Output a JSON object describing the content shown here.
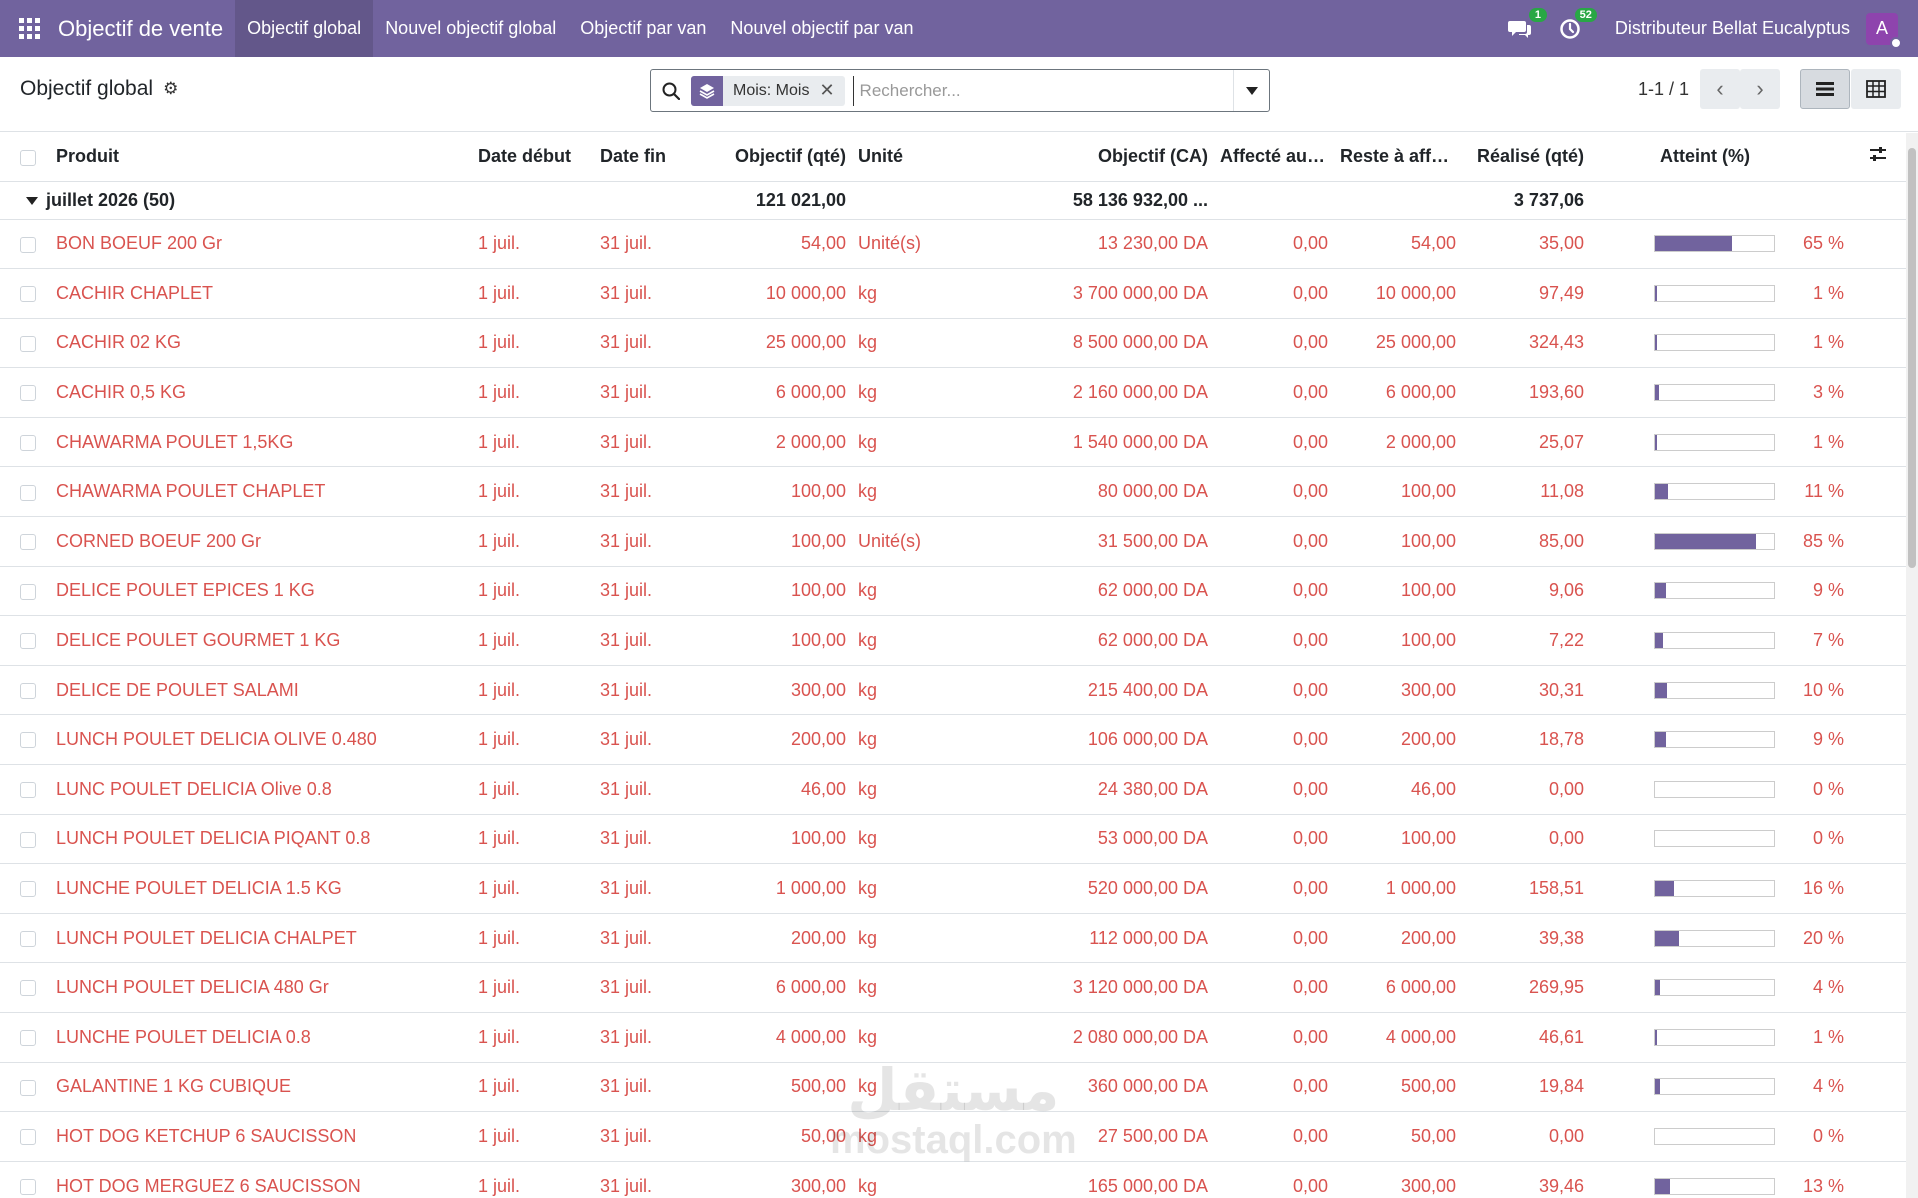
{
  "navbar": {
    "app_title": "Objectif de vente",
    "menu": [
      {
        "label": "Objectif global",
        "active": true
      },
      {
        "label": "Nouvel objectif global",
        "active": false
      },
      {
        "label": "Objectif par van",
        "active": false
      },
      {
        "label": "Nouvel objectif par van",
        "active": false
      }
    ],
    "messages_badge": "1",
    "activities_badge": "52",
    "company": "Distributeur Bellat Eucalyptus",
    "avatar_letter": "A",
    "colors": {
      "navbar_bg": "#71639e",
      "badge": "#28a745",
      "avatar": "#8e44ad"
    }
  },
  "control": {
    "breadcrumb": "Objectif global",
    "search": {
      "facet_label": "Mois: Mois",
      "placeholder": "Rechercher..."
    },
    "pager": "1-1 / 1",
    "views": [
      "list",
      "pivot"
    ]
  },
  "table": {
    "columns": [
      "Produit",
      "Date début",
      "Date fin",
      "Objectif (qté)",
      "Unité",
      "Objectif (CA)",
      "Affecté aux ...",
      "Reste à affec...",
      "Réalisé (qté)",
      "Atteint (%)"
    ],
    "group": {
      "label": "juillet 2026 (50)",
      "objectif_qte": "121 021,00",
      "objectif_ca": "58 136 932,00 ...",
      "realise_qte": "3 737,06"
    },
    "rows": [
      {
        "produit": "BON BOEUF 200 Gr",
        "debut": "1 juil.",
        "fin": "31 juil.",
        "obj_qte": "54,00",
        "unite": "Unité(s)",
        "obj_ca": "13 230,00 DA",
        "affecte": "0,00",
        "reste": "54,00",
        "realise": "35,00",
        "pct": "65 %",
        "progress": 65
      },
      {
        "produit": "CACHIR CHAPLET",
        "debut": "1 juil.",
        "fin": "31 juil.",
        "obj_qte": "10 000,00",
        "unite": "kg",
        "obj_ca": "3 700 000,00 DA",
        "affecte": "0,00",
        "reste": "10 000,00",
        "realise": "97,49",
        "pct": "1 %",
        "progress": 1
      },
      {
        "produit": "CACHIR 02 KG",
        "debut": "1 juil.",
        "fin": "31 juil.",
        "obj_qte": "25 000,00",
        "unite": "kg",
        "obj_ca": "8 500 000,00 DA",
        "affecte": "0,00",
        "reste": "25 000,00",
        "realise": "324,43",
        "pct": "1 %",
        "progress": 1
      },
      {
        "produit": "CACHIR 0,5 KG",
        "debut": "1 juil.",
        "fin": "31 juil.",
        "obj_qte": "6 000,00",
        "unite": "kg",
        "obj_ca": "2 160 000,00 DA",
        "affecte": "0,00",
        "reste": "6 000,00",
        "realise": "193,60",
        "pct": "3 %",
        "progress": 3
      },
      {
        "produit": "CHAWARMA POULET 1,5KG",
        "debut": "1 juil.",
        "fin": "31 juil.",
        "obj_qte": "2 000,00",
        "unite": "kg",
        "obj_ca": "1 540 000,00 DA",
        "affecte": "0,00",
        "reste": "2 000,00",
        "realise": "25,07",
        "pct": "1 %",
        "progress": 1
      },
      {
        "produit": "CHAWARMA POULET CHAPLET",
        "debut": "1 juil.",
        "fin": "31 juil.",
        "obj_qte": "100,00",
        "unite": "kg",
        "obj_ca": "80 000,00 DA",
        "affecte": "0,00",
        "reste": "100,00",
        "realise": "11,08",
        "pct": "11 %",
        "progress": 11
      },
      {
        "produit": "CORNED BOEUF 200 Gr",
        "debut": "1 juil.",
        "fin": "31 juil.",
        "obj_qte": "100,00",
        "unite": "Unité(s)",
        "obj_ca": "31 500,00 DA",
        "affecte": "0,00",
        "reste": "100,00",
        "realise": "85,00",
        "pct": "85 %",
        "progress": 85
      },
      {
        "produit": "DELICE POULET EPICES 1 KG",
        "debut": "1 juil.",
        "fin": "31 juil.",
        "obj_qte": "100,00",
        "unite": "kg",
        "obj_ca": "62 000,00 DA",
        "affecte": "0,00",
        "reste": "100,00",
        "realise": "9,06",
        "pct": "9 %",
        "progress": 9
      },
      {
        "produit": "DELICE POULET GOURMET 1 KG",
        "debut": "1 juil.",
        "fin": "31 juil.",
        "obj_qte": "100,00",
        "unite": "kg",
        "obj_ca": "62 000,00 DA",
        "affecte": "0,00",
        "reste": "100,00",
        "realise": "7,22",
        "pct": "7 %",
        "progress": 7
      },
      {
        "produit": "DELICE DE POULET SALAMI",
        "debut": "1 juil.",
        "fin": "31 juil.",
        "obj_qte": "300,00",
        "unite": "kg",
        "obj_ca": "215 400,00 DA",
        "affecte": "0,00",
        "reste": "300,00",
        "realise": "30,31",
        "pct": "10 %",
        "progress": 10
      },
      {
        "produit": "LUNCH POULET DELICIA OLIVE 0.480",
        "debut": "1 juil.",
        "fin": "31 juil.",
        "obj_qte": "200,00",
        "unite": "kg",
        "obj_ca": "106 000,00 DA",
        "affecte": "0,00",
        "reste": "200,00",
        "realise": "18,78",
        "pct": "9 %",
        "progress": 9
      },
      {
        "produit": "LUNC POULET DELICIA Olive 0.8",
        "debut": "1 juil.",
        "fin": "31 juil.",
        "obj_qte": "46,00",
        "unite": "kg",
        "obj_ca": "24 380,00 DA",
        "affecte": "0,00",
        "reste": "46,00",
        "realise": "0,00",
        "pct": "0 %",
        "progress": 0
      },
      {
        "produit": "LUNCH POULET DELICIA PIQANT 0.8",
        "debut": "1 juil.",
        "fin": "31 juil.",
        "obj_qte": "100,00",
        "unite": "kg",
        "obj_ca": "53 000,00 DA",
        "affecte": "0,00",
        "reste": "100,00",
        "realise": "0,00",
        "pct": "0 %",
        "progress": 0
      },
      {
        "produit": "LUNCHE POULET DELICIA 1.5 KG",
        "debut": "1 juil.",
        "fin": "31 juil.",
        "obj_qte": "1 000,00",
        "unite": "kg",
        "obj_ca": "520 000,00 DA",
        "affecte": "0,00",
        "reste": "1 000,00",
        "realise": "158,51",
        "pct": "16 %",
        "progress": 16
      },
      {
        "produit": "LUNCH POULET DELICIA CHALPET",
        "debut": "1 juil.",
        "fin": "31 juil.",
        "obj_qte": "200,00",
        "unite": "kg",
        "obj_ca": "112 000,00 DA",
        "affecte": "0,00",
        "reste": "200,00",
        "realise": "39,38",
        "pct": "20 %",
        "progress": 20
      },
      {
        "produit": "LUNCH POULET DELICIA 480 Gr",
        "debut": "1 juil.",
        "fin": "31 juil.",
        "obj_qte": "6 000,00",
        "unite": "kg",
        "obj_ca": "3 120 000,00 DA",
        "affecte": "0,00",
        "reste": "6 000,00",
        "realise": "269,95",
        "pct": "4 %",
        "progress": 4
      },
      {
        "produit": "LUNCHE POULET DELICIA 0.8",
        "debut": "1 juil.",
        "fin": "31 juil.",
        "obj_qte": "4 000,00",
        "unite": "kg",
        "obj_ca": "2 080 000,00 DA",
        "affecte": "0,00",
        "reste": "4 000,00",
        "realise": "46,61",
        "pct": "1 %",
        "progress": 1
      },
      {
        "produit": "GALANTINE 1 KG CUBIQUE",
        "debut": "1 juil.",
        "fin": "31 juil.",
        "obj_qte": "500,00",
        "unite": "kg",
        "obj_ca": "360 000,00 DA",
        "affecte": "0,00",
        "reste": "500,00",
        "realise": "19,84",
        "pct": "4 %",
        "progress": 4
      },
      {
        "produit": "HOT DOG KETCHUP 6 SAUCISSON",
        "debut": "1 juil.",
        "fin": "31 juil.",
        "obj_qte": "50,00",
        "unite": "kg",
        "obj_ca": "27 500,00 DA",
        "affecte": "0,00",
        "reste": "50,00",
        "realise": "0,00",
        "pct": "0 %",
        "progress": 0
      },
      {
        "produit": "HOT DOG MERGUEZ 6 SAUCISSON",
        "debut": "1 juil.",
        "fin": "31 juil.",
        "obj_qte": "300,00",
        "unite": "kg",
        "obj_ca": "165 000,00 DA",
        "affecte": "0,00",
        "reste": "300,00",
        "realise": "39,46",
        "pct": "13 %",
        "progress": 13
      }
    ],
    "colors": {
      "row_text": "#d9534f",
      "progress_fill": "#71639e"
    }
  },
  "watermark": {
    "arabic": "مستقل",
    "latin": "mostaql.com"
  }
}
